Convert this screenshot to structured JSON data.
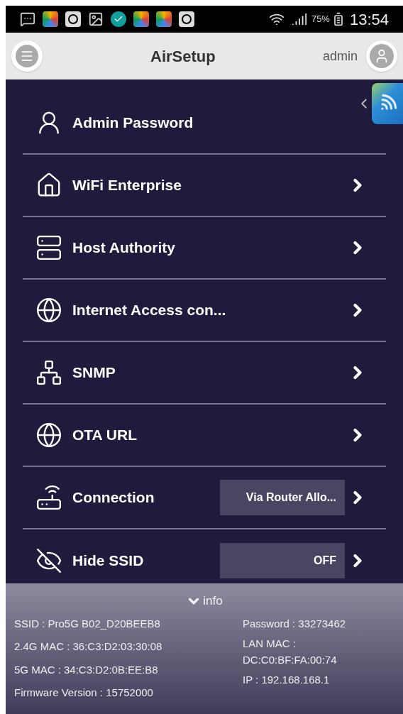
{
  "status_bar": {
    "battery": "75%",
    "time": "13:54"
  },
  "header": {
    "title": "AirSetup",
    "user": "admin"
  },
  "menu": [
    {
      "label": "Admin Password",
      "arrow": false
    },
    {
      "label": "WiFi Enterprise",
      "arrow": true
    },
    {
      "label": "Host Authority",
      "arrow": true
    },
    {
      "label": "Internet Access con...",
      "arrow": true
    },
    {
      "label": "SNMP",
      "arrow": true
    },
    {
      "label": "OTA URL",
      "arrow": true
    },
    {
      "label": "Connection",
      "arrow": true,
      "value": "Via Router Allo..."
    },
    {
      "label": "Hide SSID",
      "arrow": true,
      "value": "OFF"
    }
  ],
  "info": {
    "toggle": "info",
    "expanded": true,
    "left": [
      "SSID : Pro5G B02_D20BEEB8",
      "2.4G MAC : 36:C3:D2:03:30:08",
      "5G MAC : 34:C3:D2:0B:EE:B8",
      "Firmware Version : 15752000"
    ],
    "right": [
      "Password : 33273462",
      "LAN MAC : DC:C0:BF:FA:00:74",
      "IP : 192.168.168.1"
    ]
  }
}
